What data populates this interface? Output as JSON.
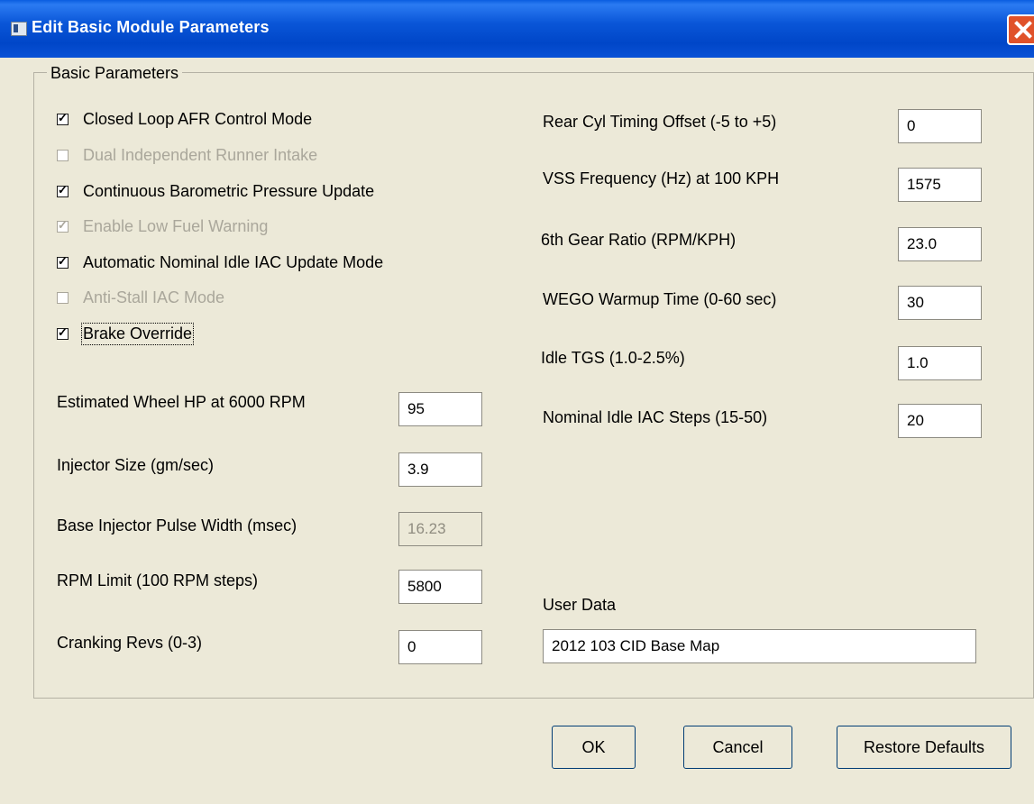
{
  "window": {
    "title": "Edit Basic Module Parameters"
  },
  "group": {
    "label": "Basic Parameters"
  },
  "checkboxes": [
    {
      "label": "Closed Loop AFR Control Mode",
      "checked": true,
      "enabled": true
    },
    {
      "label": "Dual Independent Runner Intake",
      "checked": false,
      "enabled": false
    },
    {
      "label": "Continuous Barometric Pressure Update",
      "checked": true,
      "enabled": true
    },
    {
      "label": "Enable Low Fuel Warning",
      "checked": true,
      "enabled": false
    },
    {
      "label": "Automatic Nominal Idle IAC Update Mode",
      "checked": true,
      "enabled": true
    },
    {
      "label": "Anti-Stall IAC Mode",
      "checked": false,
      "enabled": false
    },
    {
      "label": "Brake Override",
      "checked": true,
      "enabled": true
    }
  ],
  "left_fields": [
    {
      "label": "Estimated Wheel HP at 6000 RPM",
      "value": "95"
    },
    {
      "label": "Injector Size (gm/sec)",
      "value": "3.9"
    },
    {
      "label": "Base Injector Pulse Width (msec)",
      "value": "16.23",
      "enabled": false
    },
    {
      "label": "RPM Limit (100 RPM steps)",
      "value": "5800"
    },
    {
      "label": "Cranking Revs (0-3)",
      "value": "0"
    }
  ],
  "right_fields": [
    {
      "label": "Rear Cyl Timing Offset (-5 to +5)",
      "value": "0"
    },
    {
      "label": "VSS Frequency (Hz)  at 100 KPH",
      "value": "1575"
    },
    {
      "label": "6th Gear Ratio (RPM/KPH)",
      "value": "23.0"
    },
    {
      "label": "WEGO Warmup Time (0-60 sec)",
      "value": "30"
    },
    {
      "label": "Idle TGS (1.0-2.5%)",
      "value": "1.0"
    },
    {
      "label": "Nominal Idle IAC Steps (15-50)",
      "value": "20"
    }
  ],
  "user_data": {
    "label": "User Data",
    "value": "2012 103 CID Base Map"
  },
  "buttons": {
    "ok": "OK",
    "cancel": "Cancel",
    "restore": "Restore Defaults"
  },
  "colors": {
    "titlebar": "#0a56d8",
    "face": "#ece9d8",
    "disabled_text": "#aaa79b"
  }
}
